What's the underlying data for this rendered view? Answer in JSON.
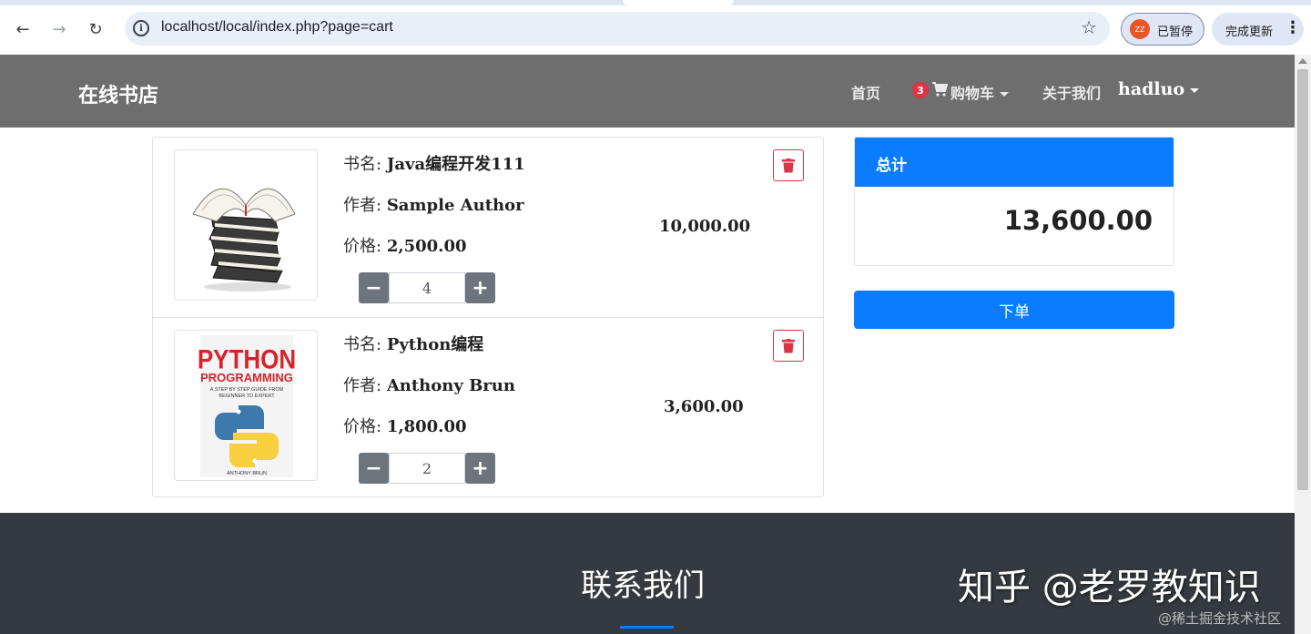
{
  "browser": {
    "url": "localhost/local/index.php?page=cart",
    "profile_initials": "ZZ",
    "profile_status": "已暂停",
    "update_label": "完成更新"
  },
  "navbar": {
    "brand": "在线书店",
    "home": "首页",
    "cart_count": "3",
    "cart_label": "购物车",
    "about": "关于我们",
    "user": "hadluo"
  },
  "cart": {
    "items": [
      {
        "title_label": "书名:",
        "title": "Java编程开发111",
        "author_label": "作者:",
        "author": "Sample Author",
        "price_label": "价格:",
        "price": "2,500.00",
        "quantity": "4",
        "subtotal": "10,000.00",
        "cover": "stack-of-books"
      },
      {
        "title_label": "书名:",
        "title": "Python编程",
        "author_label": "作者:",
        "author": "Anthony Brun",
        "price_label": "价格:",
        "price": "1,800.00",
        "quantity": "2",
        "subtotal": "3,600.00",
        "cover": "python-programming-book",
        "cover_text": {
          "line1": "PYTHON",
          "line2": "PROGRAMMING",
          "sub1": "A STEP BY STEP GUIDE FROM",
          "sub2": "BEGINNER TO EXPERT",
          "author": "ANTHONY BRUN"
        }
      }
    ]
  },
  "summary": {
    "header": "总计",
    "total": "13,600.00",
    "order_button": "下单"
  },
  "footer": {
    "title": "联系我们",
    "watermark": "知乎 @老罗教知识",
    "watermark2": "@稀土掘金技术社区"
  },
  "colors": {
    "primary": "#0a7cff",
    "navbar": "#6e6e6e",
    "footer": "#343a40",
    "danger": "#dc3545"
  }
}
